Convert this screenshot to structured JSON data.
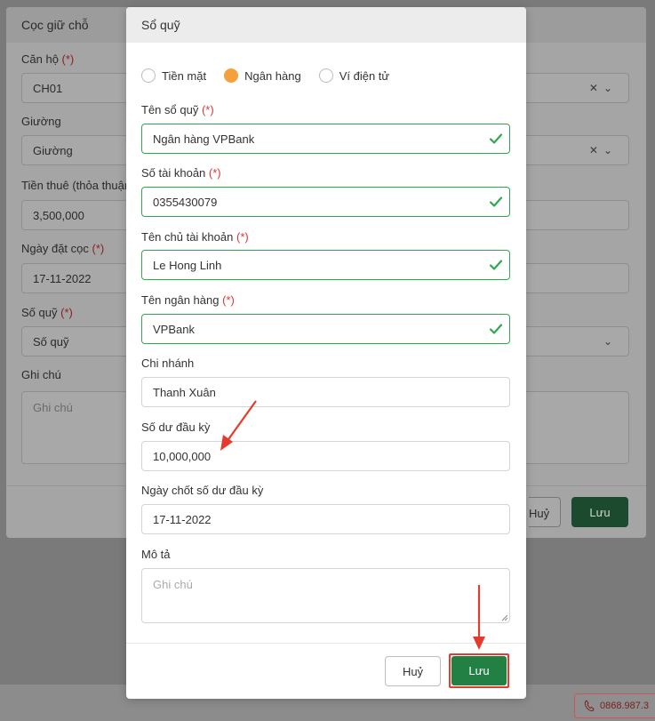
{
  "background": {
    "modal_title": "Cọc giữ chỗ",
    "fields": [
      {
        "label": "Căn hộ",
        "required": "(*)",
        "value": "CH01"
      },
      {
        "label": "Giường",
        "required": "",
        "value": "Giường"
      },
      {
        "label": "Tiền thuê (thỏa thuận",
        "required": "",
        "value": "3,500,000"
      },
      {
        "label": "Ngày đặt cọc",
        "required": "(*)",
        "value": "17-11-2022"
      },
      {
        "label": "Số quỹ",
        "required": "(*)",
        "value": "Số quỹ"
      },
      {
        "label": "Ghi chú",
        "required": "",
        "value": "Ghi chú"
      }
    ],
    "cancel_label": "Huỷ",
    "save_label": "Lưu",
    "phone": "0868.987.3"
  },
  "modal": {
    "title": "Sổ quỹ",
    "radios": [
      {
        "label": "Tiền mặt",
        "selected": false
      },
      {
        "label": "Ngân hàng",
        "selected": true
      },
      {
        "label": "Ví điện tử",
        "selected": false
      }
    ],
    "required_mark": "(*)",
    "fields": {
      "fund_name": {
        "label": "Tên sổ quỹ",
        "value": "Ngân hàng VPBank"
      },
      "account_number": {
        "label": "Số tài khoản",
        "value": "0355430079"
      },
      "account_holder": {
        "label": "Tên chủ tài khoản",
        "value": "Le Hong Linh"
      },
      "bank_name": {
        "label": "Tên ngân hàng",
        "value": "VPBank"
      },
      "branch": {
        "label": "Chi nhánh",
        "value": "Thanh Xuân"
      },
      "opening_balance": {
        "label": "Số dư đầu kỳ",
        "value": "10,000,000"
      },
      "closing_date": {
        "label": "Ngày chốt số dư đầu kỳ",
        "value": "17-11-2022"
      },
      "description": {
        "label": "Mô tả",
        "placeholder": "Ghi chú"
      }
    },
    "cancel_label": "Huỷ",
    "save_label": "Lưu"
  },
  "colors": {
    "accent_orange": "#f4a03c",
    "valid_green": "#2fa84f",
    "save_green": "#238044",
    "required_red": "#d9373a",
    "annotation_red": "#e53b2c"
  }
}
